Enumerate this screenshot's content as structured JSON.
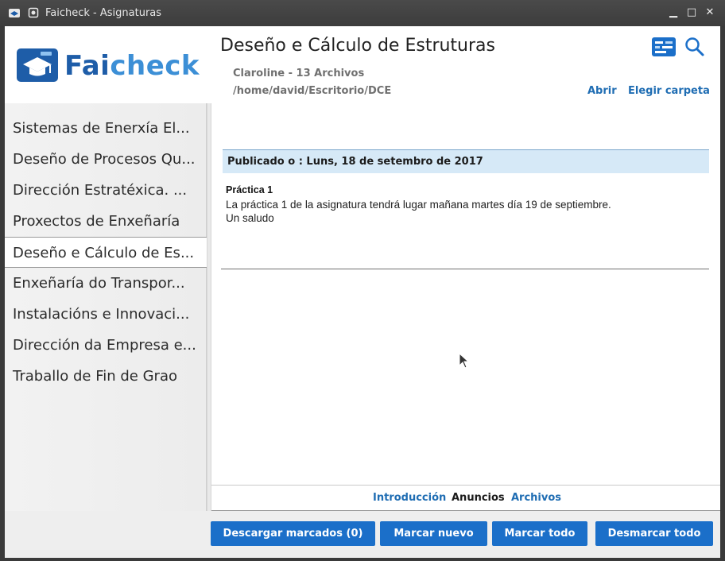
{
  "window": {
    "title": "Faicheck - Asignaturas",
    "controls": {
      "minimize": "▁",
      "maximize": "□",
      "close": "✕"
    }
  },
  "header": {
    "logo": {
      "fai": "Fai",
      "check": "check"
    },
    "course_title": "Deseño e Cálculo de Estruturas",
    "meta": "Claroline - 13 Archivos",
    "path": "/home/david/Escritorio/DCE",
    "open_link": "Abrir",
    "choose_folder_link": "Elegir carpeta",
    "icons": [
      "board-icon",
      "search-icon"
    ]
  },
  "sidebar": {
    "items": [
      {
        "label": "Sistemas de Enerxía El..."
      },
      {
        "label": "Deseño de Procesos Qu..."
      },
      {
        "label": "Dirección Estratéxica. ..."
      },
      {
        "label": "Proxectos de Enxeñaría"
      },
      {
        "label": "Deseño e Cálculo de Es..."
      },
      {
        "label": "Enxeñaría do Transpor..."
      },
      {
        "label": "Instalacións e Innovaci..."
      },
      {
        "label": "Dirección da Empresa e..."
      },
      {
        "label": "Traballo de Fin de Grao"
      }
    ],
    "selected_index": 4
  },
  "content": {
    "published": "Publicado o : Luns, 18 de setembro de 2017",
    "post_title": "Práctica 1",
    "post_line1": "La práctica 1 de la asignatura tendrá lugar mañana martes día 19 de septiembre.",
    "post_line2": "Un saludo"
  },
  "tabs": [
    {
      "label": "Introducción",
      "active": false
    },
    {
      "label": "Anuncios",
      "active": true
    },
    {
      "label": "Archivos",
      "active": false
    }
  ],
  "buttons": {
    "download": "Descargar marcados (0)",
    "mark_new": "Marcar nuevo",
    "mark_all": "Marcar todo",
    "unmark_all": "Desmarcar todo"
  },
  "colors": {
    "accent": "#1b6fc9",
    "link": "#1f6db3",
    "publish_bg": "#d6e9f7"
  }
}
